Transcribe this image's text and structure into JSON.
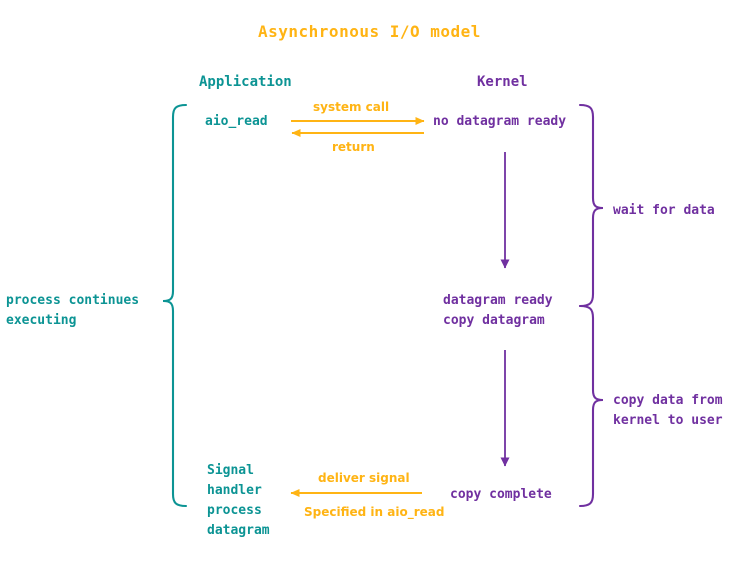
{
  "title": "Asynchronous I/O model",
  "colors": {
    "accent_orange": "#FFB414",
    "application_teal": "#0C9494",
    "kernel_purple": "#7030A0",
    "background": "#FFFFFF"
  },
  "columns": {
    "application_header": "Application",
    "kernel_header": "Kernel"
  },
  "application": {
    "step1_call": "aio_read",
    "process_state": "process continues\nexecuting",
    "signal_handler": "Signal\nhandler\nprocess\ndatagram"
  },
  "kernel": {
    "step1_state": "no datagram ready",
    "step2_state": "datagram ready\ncopy datagram",
    "step3_state": "copy complete"
  },
  "arrow_labels": {
    "system_call": "system call",
    "return": "return",
    "deliver_signal": "deliver signal",
    "specified_in": "Specified in aio_read"
  },
  "brace_labels": {
    "left_process": "process continues\nexecuting",
    "right_wait": "wait for data",
    "right_copy": "copy data from\nkernel to user"
  },
  "icons": {
    "arrow_right": "arrow-right-icon",
    "arrow_left": "arrow-left-icon",
    "arrow_down": "arrow-down-icon",
    "brace_left": "curly-brace-left-icon",
    "brace_right": "curly-brace-right-icon"
  },
  "chart_data": {
    "type": "diagram",
    "title": "Asynchronous I/O model",
    "lanes": [
      "Application",
      "Kernel"
    ],
    "steps": [
      {
        "index": 1,
        "application": "aio_read",
        "kernel": "no datagram ready",
        "transition_out": "system call",
        "transition_in": "return"
      },
      {
        "index": 2,
        "application": "process continues executing",
        "kernel": "datagram ready copy datagram",
        "phase": "wait for data"
      },
      {
        "index": 3,
        "application": "Signal handler process datagram",
        "kernel": "copy complete",
        "transition_in": "deliver signal",
        "note": "Specified in aio_read",
        "phase": "copy data from kernel to user"
      }
    ]
  }
}
